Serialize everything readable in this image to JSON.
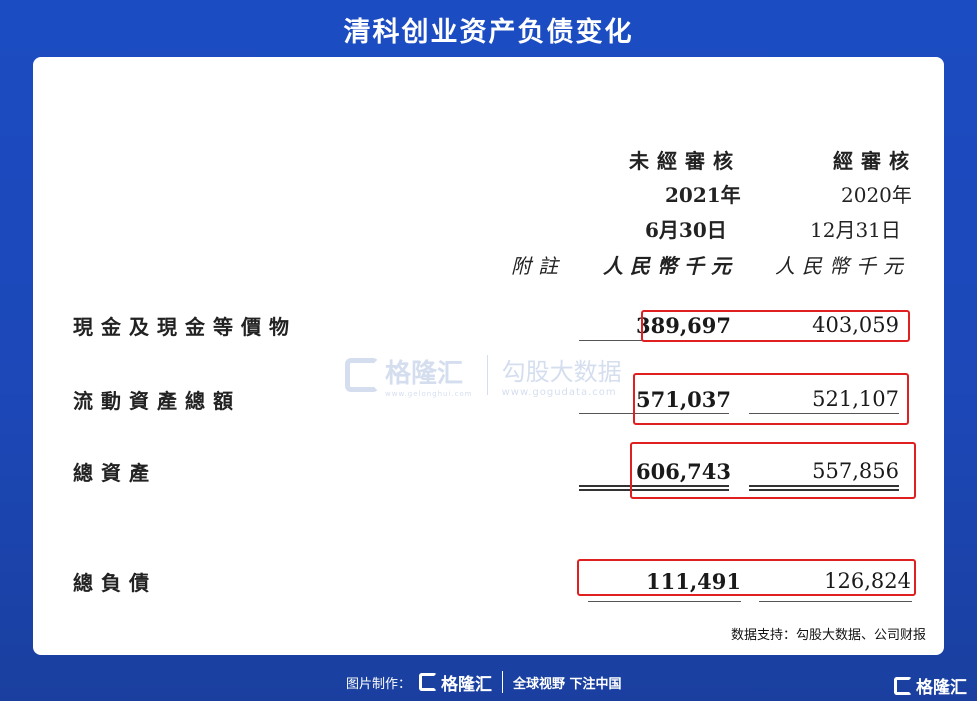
{
  "title": "清科创业资产负债变化",
  "table": {
    "col_unaudited": "未經審核",
    "col_audited": "經審核",
    "col_unaudited_year": "2021年",
    "col_audited_year": "2020年",
    "col_unaudited_date": "6月30日",
    "col_audited_date": "12月31日",
    "note_header": "附註",
    "unit_unaudited": "人民幣千元",
    "unit_audited": "人民幣千元",
    "rows": [
      {
        "label": "現金及現金等價物",
        "v2021": "389,697",
        "v2020": "403,059"
      },
      {
        "label": "流動資產總額",
        "v2021": "571,037",
        "v2020": "521,107"
      },
      {
        "label": "總資產",
        "v2021": "606,743",
        "v2020": "557,856"
      },
      {
        "label": "總負債",
        "v2021": "111,491",
        "v2020": "126,824"
      }
    ]
  },
  "watermark": {
    "brand": "格隆汇",
    "brand_url": "www.gelonghui.com",
    "partner": "勾股大数据",
    "partner_url": "www.gogudata.com"
  },
  "source": "数据支持：勾股大数据、公司财报",
  "footer": {
    "made_by": "图片制作：",
    "logo": "格隆汇",
    "slogan": "全球视野 下注中国",
    "corner_logo": "格隆汇"
  },
  "colors": {
    "background": "#1c4cc2",
    "highlight": "#e02020"
  }
}
